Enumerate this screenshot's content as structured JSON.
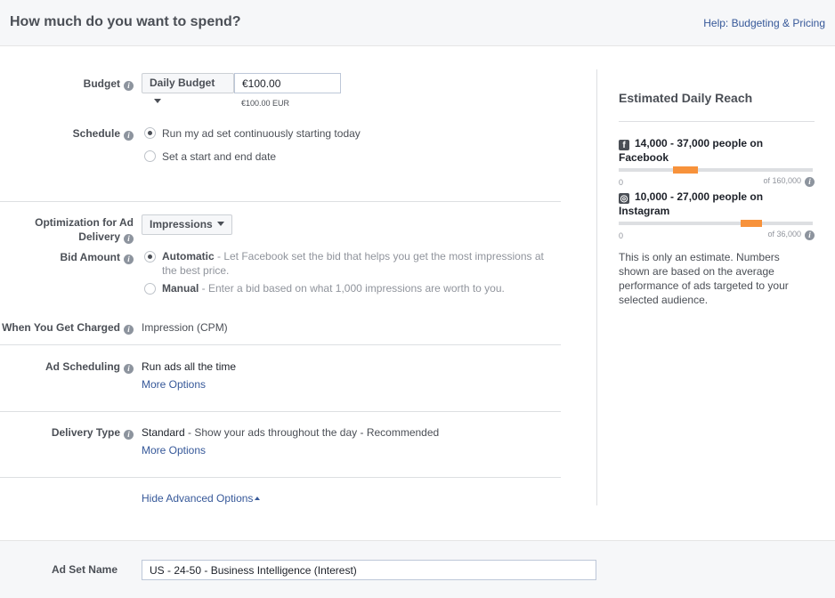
{
  "header": {
    "title": "How much do you want to spend?",
    "help_link": "Help: Budgeting & Pricing"
  },
  "budget": {
    "label": "Budget",
    "type_button": "Daily Budget",
    "amount": "€100.00",
    "amount_note": "€100.00 EUR"
  },
  "schedule": {
    "label": "Schedule",
    "option_continuous": "Run my ad set continuously starting today",
    "option_dates": "Set a start and end date",
    "selected": "continuous"
  },
  "optimization": {
    "label": "Optimization for Ad Delivery",
    "button": "Impressions"
  },
  "bid_amount": {
    "label": "Bid Amount",
    "automatic_title": "Automatic",
    "automatic_desc": " - Let Facebook set the bid that helps you get the most impressions at the best price.",
    "manual_title": "Manual",
    "manual_desc": " - Enter a bid based on what 1,000 impressions are worth to you.",
    "selected": "automatic"
  },
  "charged": {
    "label": "When You Get Charged",
    "value": "Impression (CPM)"
  },
  "ad_scheduling": {
    "label": "Ad Scheduling",
    "value": "Run ads all the time",
    "more": "More Options"
  },
  "delivery_type": {
    "label": "Delivery Type",
    "value": "Standard",
    "desc": " - Show your ads throughout the day - Recommended",
    "more": "More Options"
  },
  "advanced": {
    "hide_link": "Hide Advanced Options"
  },
  "reach": {
    "title": "Estimated Daily Reach",
    "facebook": {
      "text": "14,000 - 37,000 people on Facebook",
      "min": "0",
      "max": "of 160,000",
      "range_start": 0.28,
      "range_end": 0.41
    },
    "instagram": {
      "text": "10,000 - 27,000 people on Instagram",
      "min": "0",
      "max": "of 36,000",
      "range_start": 0.63,
      "range_end": 0.74
    },
    "disclaimer": "This is only an estimate. Numbers shown are based on the average performance of ads targeted to your selected audience."
  },
  "ad_set_name": {
    "label": "Ad Set Name",
    "value": "US - 24-50 - Business Intelligence (Interest)"
  },
  "colors": {
    "accent_link": "#365899",
    "reach_bar": "#f7923b"
  }
}
